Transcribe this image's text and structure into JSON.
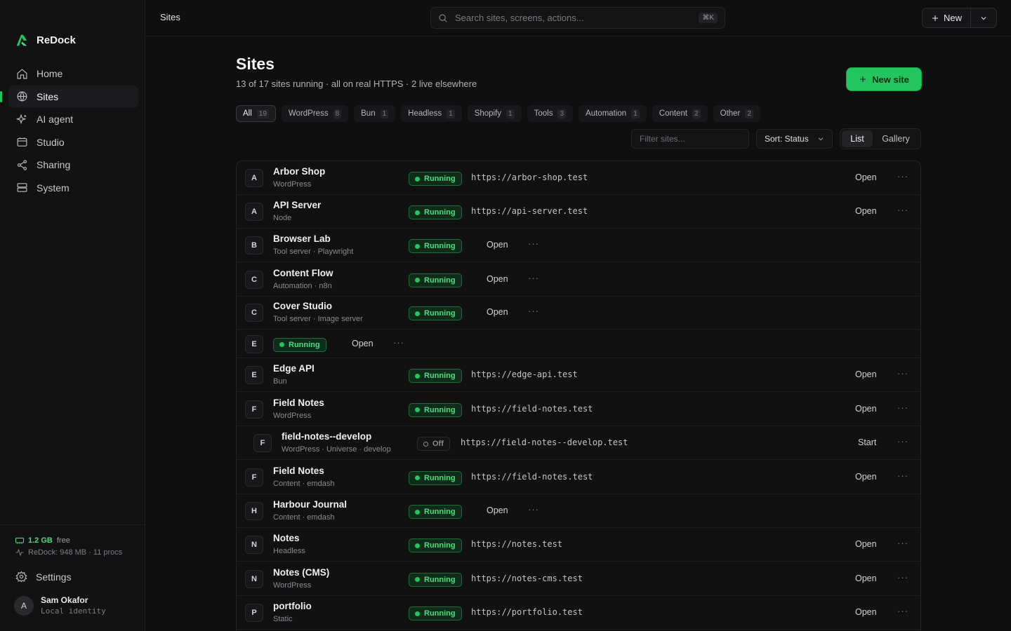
{
  "app": {
    "name": "ReDock"
  },
  "sidebar": {
    "items": [
      {
        "label": "Home",
        "icon": "home-icon"
      },
      {
        "label": "Sites",
        "icon": "globe-icon",
        "active": true
      },
      {
        "label": "AI agent",
        "icon": "sparkle-icon"
      },
      {
        "label": "Studio",
        "icon": "window-icon"
      },
      {
        "label": "Sharing",
        "icon": "share-icon"
      },
      {
        "label": "System",
        "icon": "server-icon"
      }
    ],
    "memory": {
      "value": "1.2 GB",
      "free_label": "free",
      "process_info": "ReDock: 948 MB · 11 procs"
    },
    "settings_label": "Settings",
    "user": {
      "initial": "A",
      "name": "Sam Okafor",
      "sub": "Local identity"
    }
  },
  "topbar": {
    "breadcrumb": "Sites",
    "search_placeholder": "Search sites, screens, actions...",
    "search_shortcut": "⌘K",
    "new_label": "New"
  },
  "page": {
    "title": "Sites",
    "subtitle": "13 of 17 sites running · all on real HTTPS · 2 live elsewhere",
    "new_site_label": "New site",
    "filter_placeholder": "Filter sites...",
    "sort_label": "Sort: Status",
    "views": [
      "List",
      "Gallery"
    ],
    "accent_color": "#22c55e"
  },
  "tabs": [
    {
      "label": "All",
      "count": "19",
      "active": true
    },
    {
      "label": "WordPress",
      "count": "8"
    },
    {
      "label": "Bun",
      "count": "1"
    },
    {
      "label": "Headless",
      "count": "1"
    },
    {
      "label": "Shopify",
      "count": "1"
    },
    {
      "label": "Tools",
      "count": "3"
    },
    {
      "label": "Automation",
      "count": "1"
    },
    {
      "label": "Content",
      "count": "2"
    },
    {
      "label": "Other",
      "count": "2"
    }
  ],
  "sites": [
    {
      "letter": "A",
      "name": "Arbor Shop",
      "sub": "WordPress",
      "status": "Running",
      "url": "https://arbor-shop.test",
      "action": "Open"
    },
    {
      "letter": "A",
      "name": "API Server",
      "sub": "Node",
      "status": "Running",
      "url": "https://api-server.test",
      "action": "Open"
    },
    {
      "letter": "B",
      "name": "Browser Lab",
      "sub": "Tool server · Playwright",
      "status": "Running",
      "url": "",
      "action": "Open"
    },
    {
      "letter": "C",
      "name": "Content Flow",
      "sub": "Automation · n8n",
      "status": "Running",
      "url": "",
      "action": "Open"
    },
    {
      "letter": "C",
      "name": "Cover Studio",
      "sub": "Tool server · Image server",
      "status": "Running",
      "url": "",
      "action": "Open"
    },
    {
      "letter": "E",
      "name": "",
      "sub": "",
      "status": "Running",
      "url": "",
      "action": "Open"
    },
    {
      "letter": "E",
      "name": "Edge API",
      "sub": "Bun",
      "status": "Running",
      "url": "https://edge-api.test",
      "action": "Open"
    },
    {
      "letter": "F",
      "name": "Field Notes",
      "sub": "WordPress",
      "status": "Running",
      "url": "https://field-notes.test",
      "action": "Open"
    },
    {
      "letter": "F",
      "name": "field-notes--develop",
      "sub": "WordPress · Universe · develop",
      "status": "Off",
      "url": "https://field-notes--develop.test",
      "action": "Start",
      "nested": true
    },
    {
      "letter": "F",
      "name": "Field Notes",
      "sub": "Content · emdash",
      "status": "Running",
      "url": "https://field-notes.test",
      "action": "Open"
    },
    {
      "letter": "H",
      "name": "Harbour Journal",
      "sub": "Content · emdash",
      "status": "Running",
      "url": "",
      "action": "Open"
    },
    {
      "letter": "N",
      "name": "Notes",
      "sub": "Headless",
      "status": "Running",
      "url": "https://notes.test",
      "action": "Open"
    },
    {
      "letter": "N",
      "name": "Notes (CMS)",
      "sub": "WordPress",
      "status": "Running",
      "url": "https://notes-cms.test",
      "action": "Open"
    },
    {
      "letter": "P",
      "name": "portfolio",
      "sub": "Static",
      "status": "Running",
      "url": "https://portfolio.test",
      "action": "Open"
    }
  ],
  "more_label": "···"
}
